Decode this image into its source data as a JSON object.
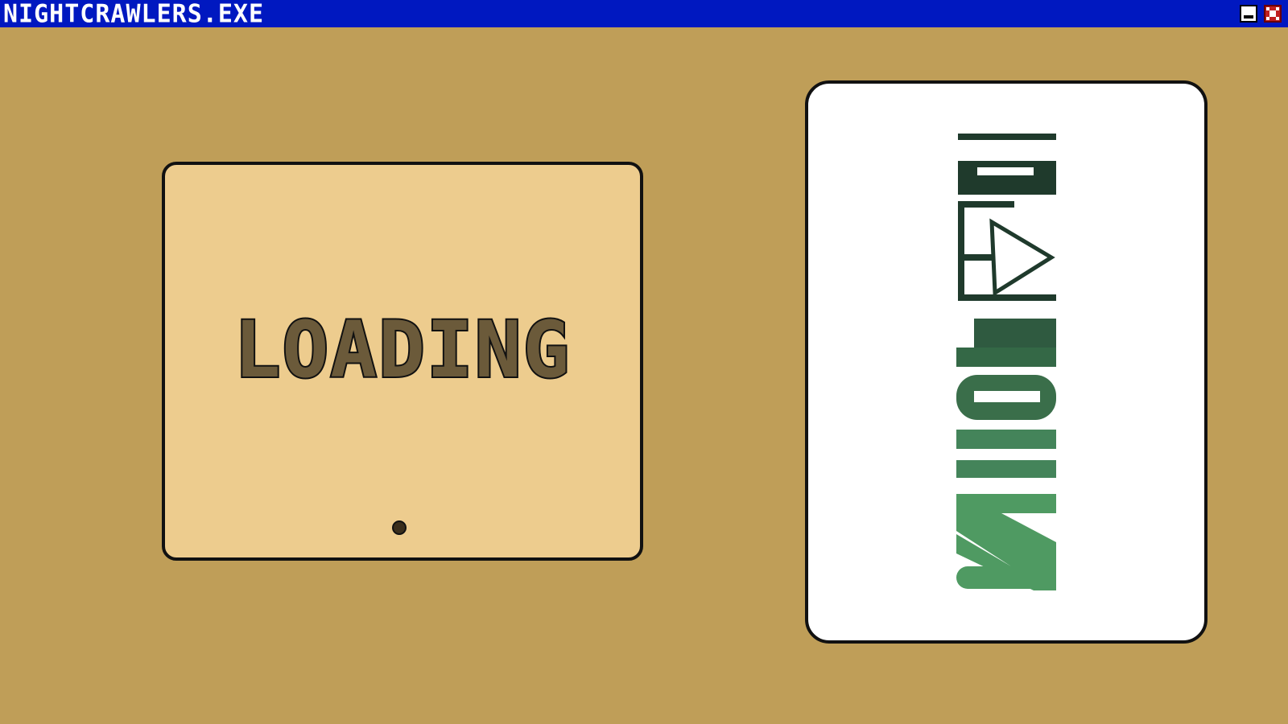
{
  "window": {
    "title": "NIGHTCRAWLERS.EXE",
    "minimize_icon": "minimize-icon",
    "close_icon": "close-icon"
  },
  "loading_panel": {
    "label": "LOADING"
  },
  "logo_card": {
    "logo_word": "ACTIONS",
    "colors": {
      "dark": "#1F3A2C",
      "mid": "#3F7552",
      "light": "#4F9A62"
    }
  },
  "colors": {
    "background": "#BF9E58",
    "titlebar": "#0018C0",
    "panel": "#EDCC8E",
    "loading_text": "#6B5A3A",
    "close_button": "#C02020"
  }
}
